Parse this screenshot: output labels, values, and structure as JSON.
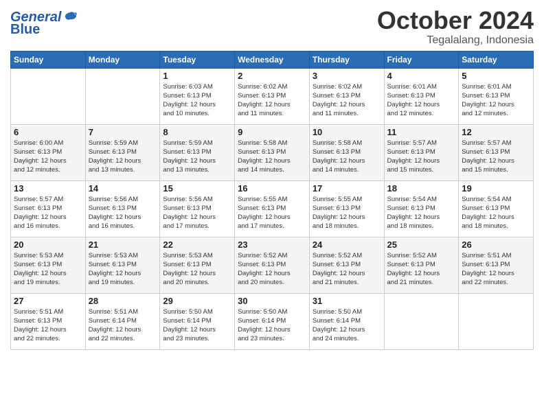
{
  "header": {
    "logo_line1": "General",
    "logo_line2": "Blue",
    "month": "October 2024",
    "location": "Tegalalang, Indonesia"
  },
  "weekdays": [
    "Sunday",
    "Monday",
    "Tuesday",
    "Wednesday",
    "Thursday",
    "Friday",
    "Saturday"
  ],
  "weeks": [
    [
      {
        "num": "",
        "info": ""
      },
      {
        "num": "",
        "info": ""
      },
      {
        "num": "1",
        "info": "Sunrise: 6:03 AM\nSunset: 6:13 PM\nDaylight: 12 hours\nand 10 minutes."
      },
      {
        "num": "2",
        "info": "Sunrise: 6:02 AM\nSunset: 6:13 PM\nDaylight: 12 hours\nand 11 minutes."
      },
      {
        "num": "3",
        "info": "Sunrise: 6:02 AM\nSunset: 6:13 PM\nDaylight: 12 hours\nand 11 minutes."
      },
      {
        "num": "4",
        "info": "Sunrise: 6:01 AM\nSunset: 6:13 PM\nDaylight: 12 hours\nand 12 minutes."
      },
      {
        "num": "5",
        "info": "Sunrise: 6:01 AM\nSunset: 6:13 PM\nDaylight: 12 hours\nand 12 minutes."
      }
    ],
    [
      {
        "num": "6",
        "info": "Sunrise: 6:00 AM\nSunset: 6:13 PM\nDaylight: 12 hours\nand 12 minutes."
      },
      {
        "num": "7",
        "info": "Sunrise: 5:59 AM\nSunset: 6:13 PM\nDaylight: 12 hours\nand 13 minutes."
      },
      {
        "num": "8",
        "info": "Sunrise: 5:59 AM\nSunset: 6:13 PM\nDaylight: 12 hours\nand 13 minutes."
      },
      {
        "num": "9",
        "info": "Sunrise: 5:58 AM\nSunset: 6:13 PM\nDaylight: 12 hours\nand 14 minutes."
      },
      {
        "num": "10",
        "info": "Sunrise: 5:58 AM\nSunset: 6:13 PM\nDaylight: 12 hours\nand 14 minutes."
      },
      {
        "num": "11",
        "info": "Sunrise: 5:57 AM\nSunset: 6:13 PM\nDaylight: 12 hours\nand 15 minutes."
      },
      {
        "num": "12",
        "info": "Sunrise: 5:57 AM\nSunset: 6:13 PM\nDaylight: 12 hours\nand 15 minutes."
      }
    ],
    [
      {
        "num": "13",
        "info": "Sunrise: 5:57 AM\nSunset: 6:13 PM\nDaylight: 12 hours\nand 16 minutes."
      },
      {
        "num": "14",
        "info": "Sunrise: 5:56 AM\nSunset: 6:13 PM\nDaylight: 12 hours\nand 16 minutes."
      },
      {
        "num": "15",
        "info": "Sunrise: 5:56 AM\nSunset: 6:13 PM\nDaylight: 12 hours\nand 17 minutes."
      },
      {
        "num": "16",
        "info": "Sunrise: 5:55 AM\nSunset: 6:13 PM\nDaylight: 12 hours\nand 17 minutes."
      },
      {
        "num": "17",
        "info": "Sunrise: 5:55 AM\nSunset: 6:13 PM\nDaylight: 12 hours\nand 18 minutes."
      },
      {
        "num": "18",
        "info": "Sunrise: 5:54 AM\nSunset: 6:13 PM\nDaylight: 12 hours\nand 18 minutes."
      },
      {
        "num": "19",
        "info": "Sunrise: 5:54 AM\nSunset: 6:13 PM\nDaylight: 12 hours\nand 18 minutes."
      }
    ],
    [
      {
        "num": "20",
        "info": "Sunrise: 5:53 AM\nSunset: 6:13 PM\nDaylight: 12 hours\nand 19 minutes."
      },
      {
        "num": "21",
        "info": "Sunrise: 5:53 AM\nSunset: 6:13 PM\nDaylight: 12 hours\nand 19 minutes."
      },
      {
        "num": "22",
        "info": "Sunrise: 5:53 AM\nSunset: 6:13 PM\nDaylight: 12 hours\nand 20 minutes."
      },
      {
        "num": "23",
        "info": "Sunrise: 5:52 AM\nSunset: 6:13 PM\nDaylight: 12 hours\nand 20 minutes."
      },
      {
        "num": "24",
        "info": "Sunrise: 5:52 AM\nSunset: 6:13 PM\nDaylight: 12 hours\nand 21 minutes."
      },
      {
        "num": "25",
        "info": "Sunrise: 5:52 AM\nSunset: 6:13 PM\nDaylight: 12 hours\nand 21 minutes."
      },
      {
        "num": "26",
        "info": "Sunrise: 5:51 AM\nSunset: 6:13 PM\nDaylight: 12 hours\nand 22 minutes."
      }
    ],
    [
      {
        "num": "27",
        "info": "Sunrise: 5:51 AM\nSunset: 6:13 PM\nDaylight: 12 hours\nand 22 minutes."
      },
      {
        "num": "28",
        "info": "Sunrise: 5:51 AM\nSunset: 6:14 PM\nDaylight: 12 hours\nand 22 minutes."
      },
      {
        "num": "29",
        "info": "Sunrise: 5:50 AM\nSunset: 6:14 PM\nDaylight: 12 hours\nand 23 minutes."
      },
      {
        "num": "30",
        "info": "Sunrise: 5:50 AM\nSunset: 6:14 PM\nDaylight: 12 hours\nand 23 minutes."
      },
      {
        "num": "31",
        "info": "Sunrise: 5:50 AM\nSunset: 6:14 PM\nDaylight: 12 hours\nand 24 minutes."
      },
      {
        "num": "",
        "info": ""
      },
      {
        "num": "",
        "info": ""
      }
    ]
  ]
}
